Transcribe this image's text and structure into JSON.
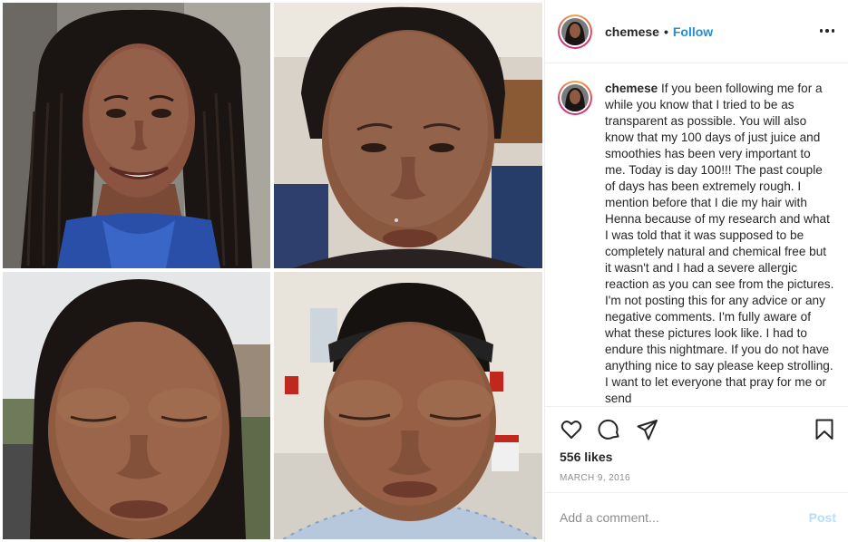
{
  "post": {
    "photos": [
      {
        "description_icon": "photo-smiling"
      },
      {
        "description_icon": "photo-swelling-start"
      },
      {
        "description_icon": "photo-swelling-eyes"
      },
      {
        "description_icon": "photo-hospital"
      }
    ]
  },
  "header": {
    "username": "chemese",
    "separator": "•",
    "follow_label": "Follow",
    "more_icon": "more-horizontal-icon"
  },
  "caption": {
    "username": "chemese",
    "text": "If you been following me for a while you know that I tried to be as transparent as possible. You will also know that my 100 days of just juice and smoothies has been very important to me. Today is day 100!!! The past couple of days has been extremely rough. I mention before that I die my hair with Henna because of my research and what I was told that it was supposed to be completely natural and chemical free but it wasn't and I had a severe allergic reaction as you can see from the pictures. I'm not posting this for any advice or any negative comments. I'm fully aware of what these pictures look like. I had to endure this nightmare. If you do not have anything nice to say please keep strolling. I want to let everyone that pray for me or send"
  },
  "actions": {
    "icons": [
      "heart-icon",
      "comment-icon",
      "share-icon",
      "bookmark-icon"
    ],
    "likes": "556 likes",
    "date": "MARCH 9, 2016"
  },
  "comment": {
    "placeholder": "Add a comment...",
    "post_label": "Post"
  },
  "colors": {
    "accent": "#1e8fd6",
    "post_disabled": "#b2dffc",
    "text": "#262626",
    "muted": "#8e8e8e",
    "divider": "#efefef"
  }
}
